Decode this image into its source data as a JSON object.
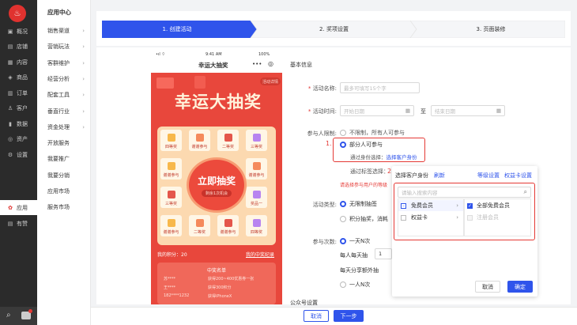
{
  "nav": {
    "logo_glyph": "♨",
    "items": [
      {
        "label": "概况",
        "icon": "overview-icon",
        "glyph": "▣"
      },
      {
        "label": "店铺",
        "icon": "store-icon",
        "glyph": "▤"
      },
      {
        "label": "内容",
        "icon": "content-icon",
        "glyph": "▦"
      },
      {
        "label": "商品",
        "icon": "goods-icon",
        "glyph": "◈"
      },
      {
        "label": "订单",
        "icon": "order-icon",
        "glyph": "▥"
      },
      {
        "label": "客户",
        "icon": "customer-icon",
        "glyph": "♙"
      },
      {
        "label": "数据",
        "icon": "data-icon",
        "glyph": "▮"
      },
      {
        "label": "资产",
        "icon": "asset-icon",
        "glyph": "◎"
      },
      {
        "label": "设置",
        "icon": "settings-icon",
        "glyph": "⚙"
      }
    ],
    "app_label": "应用",
    "app_glyph": "✿",
    "reward_label": "有赞",
    "reward_glyph": "▤"
  },
  "side": {
    "title": "应用中心",
    "items": [
      {
        "label": "销售渠道",
        "chev": "›"
      },
      {
        "label": "营销玩法",
        "chev": "›"
      },
      {
        "label": "客群维护",
        "chev": "›"
      },
      {
        "label": "经营分析",
        "chev": "›"
      },
      {
        "label": "配套工具",
        "chev": "›"
      },
      {
        "label": "垂直行业",
        "chev": "›"
      },
      {
        "label": "资金处理",
        "chev": "›"
      },
      {
        "label": "开放服务",
        "chev": ""
      },
      {
        "label": "我要推广",
        "chev": ""
      },
      {
        "label": "我要分销",
        "chev": ""
      },
      {
        "label": "应用市场",
        "chev": ""
      },
      {
        "label": "服务市场",
        "chev": ""
      }
    ]
  },
  "steps": [
    "1. 创建活动",
    "2. 奖项设置",
    "3. 页面装修"
  ],
  "phone": {
    "signal": "•ıl ⌔",
    "time": "9:41 AM",
    "battery": "100%",
    "title": "幸运大抽奖",
    "more": "•••",
    "target": "◎",
    "rules": "活动详情",
    "banner": "幸运大抽奖",
    "prizes": [
      "四等奖",
      "谢谢参与",
      "二等奖",
      "三等奖",
      "谢谢参与",
      "谢谢参与",
      "三等奖",
      "奖品一",
      "谢谢参与",
      "二等奖",
      "谢谢参与",
      "四等奖"
    ],
    "draw_btn": "立即抽奖",
    "draw_sub": "剩余1次机会",
    "points": "我的积分：20",
    "my_prizes": "我的中奖纪录",
    "winners_title": "中奖名单",
    "winners": [
      {
        "name": "苏****",
        "prize": "获得200~400优惠券一张"
      },
      {
        "name": "王****",
        "prize": "获得300积分"
      },
      {
        "name": "182****1232",
        "prize": "获得iPhoneX"
      }
    ]
  },
  "form": {
    "section": "基本信息",
    "name_label": "活动名称:",
    "name_placeholder": "最多可填写15个字",
    "time_label": "活动时间:",
    "start_placeholder": "开始日期",
    "end_placeholder": "结束日期",
    "to": "至",
    "calendar_glyph": "▦",
    "limit_label": "参与人限制:",
    "opt_unlimited": "不限制，所有人可参与",
    "opt_partial": "部分人可参与",
    "identity_label": "通过身份选择：",
    "identity_link": "选择客户身份",
    "tag_label": "通过标签选择：",
    "hint": "请选择参与用户的等级",
    "type_label": "活动类型:",
    "type_unlimited": "无限制抽签",
    "type_points": "积分抽奖，消耗",
    "times_label": "参与次数:",
    "times_opt1": "一天N次",
    "times_daily": "每人每天抽",
    "times_daily_val": "1",
    "times_share": "每天分享额外抽",
    "times_opt2": "一人N次",
    "public_label": "公众号设置",
    "anno1": "1.",
    "anno2": "2."
  },
  "popup": {
    "title": "选择客户身份",
    "refresh": "刷新",
    "level_settings": "等级设置",
    "card_settings": "权益卡设置",
    "search_placeholder": "请输入搜索内容",
    "search_glyph": "⌕",
    "left": [
      {
        "label": "免费会员",
        "chev": "›"
      },
      {
        "label": "权益卡",
        "chev": "›"
      }
    ],
    "right": [
      {
        "label": "全部免费会员",
        "check": "✓"
      },
      {
        "label": "注册会员",
        "check": ""
      }
    ],
    "cancel": "取消",
    "ok": "确定"
  },
  "footer": {
    "cancel": "取消",
    "next": "下一步"
  },
  "colors": {
    "accent": "#2f54eb",
    "red": "#e53935",
    "nav": "#2b2b2b"
  }
}
